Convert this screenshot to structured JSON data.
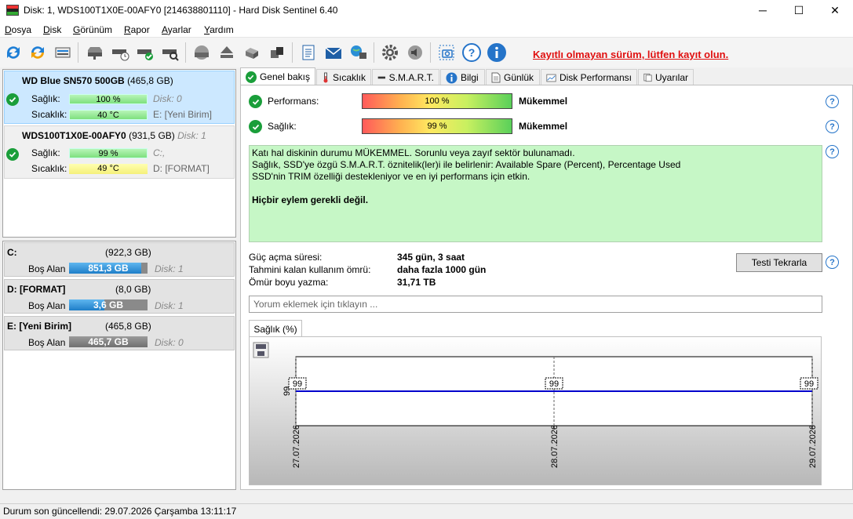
{
  "window": {
    "title": "Disk: 1, WDS100T1X0E-00AFY0 [214638801110]  -  Hard Disk Sentinel 6.40",
    "minimize": "─",
    "maximize": "☐",
    "close": "✕"
  },
  "menu": [
    "Dosya",
    "Disk",
    "Görünüm",
    "Rapor",
    "Ayarlar",
    "Yardım"
  ],
  "toolbar": {
    "icons": [
      "refresh-icon",
      "refresh-all-icon",
      "disk-info-icon",
      "disk-icon",
      "disk-clock-icon",
      "disk-check-icon",
      "disk-search-icon",
      "surface-test-icon",
      "eject-icon",
      "disk-stack-icon",
      "disk-copy-icon",
      "report-icon",
      "email-icon",
      "network-icon",
      "settings-icon",
      "sound-icon",
      "screenshot-icon",
      "help-icon",
      "info-icon"
    ],
    "register_text": "Kayıtlı olmayan sürüm, lütfen kayıt olun."
  },
  "disks": [
    {
      "name": "WD Blue SN570 500GB",
      "size": "(465,8 GB)",
      "sub": "",
      "health_label": "Sağlık:",
      "health": "100 %",
      "health_value": 100,
      "temp_label": "Sıcaklık:",
      "temp": "40 °C",
      "vol1": "Disk: 0",
      "vol2": "E: [Yeni Birim]"
    },
    {
      "name": "WDS100T1X0E-00AFY0",
      "size": "(931,5 GB)",
      "sub": "Disk: 1",
      "health_label": "Sağlık:",
      "health": "99 %",
      "health_value": 99,
      "temp_label": "Sıcaklık:",
      "temp": "49 °C",
      "vol1": "C:,",
      "vol2": "D: [FORMAT]"
    }
  ],
  "volumes": [
    {
      "name": "C:",
      "size": "(922,3 GB)",
      "free_label": "Boş Alan",
      "free": "851,3 GB",
      "free_fraction": 0.92,
      "disk": "Disk: 1"
    },
    {
      "name": "D: [FORMAT]",
      "size": "(8,0 GB)",
      "free_label": "Boş Alan",
      "free": "3,6 GB",
      "free_fraction": 0.45,
      "disk": "Disk: 1"
    },
    {
      "name": "E: [Yeni Birim]",
      "size": "(465,8 GB)",
      "free_label": "Boş Alan",
      "free": "465,7 GB",
      "free_fraction": 1.0,
      "disk": "Disk: 0"
    }
  ],
  "tabs": [
    "Genel bakış",
    "Sıcaklık",
    "S.M.A.R.T.",
    "Bilgi",
    "Günlük",
    "Disk Performansı",
    "Uyarılar"
  ],
  "overview": {
    "performance_label": "Performans:",
    "performance": "100 %",
    "performance_value": 100,
    "performance_rating": "Mükemmel",
    "health_label": "Sağlık:",
    "health": "99 %",
    "health_value": 99,
    "health_rating": "Mükemmel",
    "message_lines": [
      "Katı hal diskinin durumu MÜKEMMEL. Sorunlu veya zayıf sektör bulunamadı.",
      "Sağlık, SSD'ye özgü S.M.A.R.T. öznitelik(ler)i ile belirlenir:  Available Spare (Percent), Percentage Used",
      "SSD'nin TRIM özelliği destekleniyor ve en iyi performans için etkin."
    ],
    "message_action": "Hiçbir eylem gerekli değil.",
    "power_on_label": "Güç açma süresi:",
    "power_on": "345 gün, 3 saat",
    "remaining_label": "Tahmini kalan kullanım ömrü:",
    "remaining": "daha fazla 1000 gün",
    "written_label": "Ömür boyu yazma:",
    "written": "31,71 TB",
    "retest_button": "Testi Tekrarla",
    "comment_placeholder": "Yorum eklemek için tıklayın ...",
    "health_tab": "Sağlık (%)",
    "help": "?"
  },
  "chart_data": {
    "type": "line",
    "x": [
      "27.07.2026",
      "28.07.2026",
      "29.07.2026"
    ],
    "series": [
      {
        "values": [
          99,
          99,
          99
        ],
        "color": "#0000cc"
      }
    ],
    "ytick": "99",
    "point_labels": [
      "99",
      "99",
      "99"
    ]
  },
  "status": "Durum son güncellendi: 29.07.2026 Çarşamba 13:11:17"
}
